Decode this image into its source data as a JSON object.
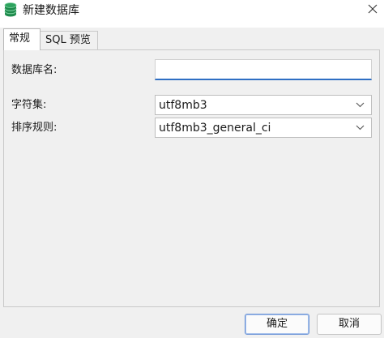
{
  "window": {
    "title": "新建数据库",
    "icon": "database-icon"
  },
  "tabs": [
    {
      "label": "常规",
      "active": true
    },
    {
      "label": "SQL 预览",
      "active": false
    }
  ],
  "form": {
    "db_name": {
      "label": "数据库名:",
      "value": ""
    },
    "charset": {
      "label": "字符集:",
      "value": "utf8mb3"
    },
    "collation": {
      "label": "排序规则:",
      "value": "utf8mb3_general_ci"
    }
  },
  "buttons": {
    "ok": "确定",
    "cancel": "取消"
  },
  "colors": {
    "accent": "#2f6fc4",
    "db_icon": "#1e8a4c"
  }
}
